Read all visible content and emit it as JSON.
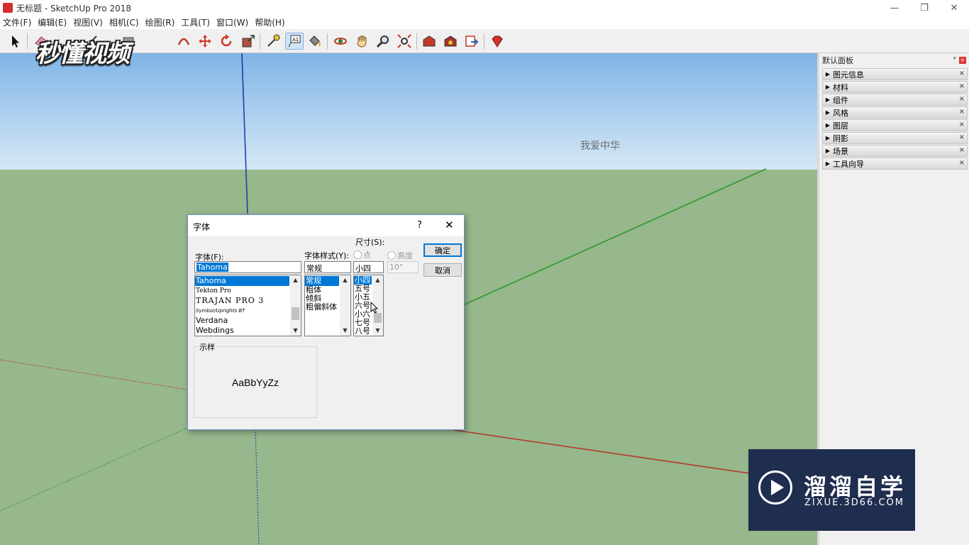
{
  "window": {
    "title": "无标题 - SketchUp Pro 2018",
    "controls": [
      "—",
      "❐",
      "✕"
    ]
  },
  "menu": [
    "文件(F)",
    "编辑(E)",
    "视图(V)",
    "相机(C)",
    "绘图(R)",
    "工具(T)",
    "窗口(W)",
    "帮助(H)"
  ],
  "toolbar": {
    "icons": [
      "select-icon",
      "eraser-icon",
      "line-icon",
      "rectangle-icon",
      "arc-icon",
      "move-icon",
      "rotate-icon",
      "push-pull-icon",
      "tape-measure-icon",
      "text-icon",
      "paint-bucket-icon",
      "orbit-icon",
      "pan-icon",
      "zoom-icon",
      "zoom-extents-icon",
      "warehouse-icon",
      "extension-icon",
      "send-to-layout-icon",
      "ruby-icon"
    ]
  },
  "viewport": {
    "text_label": "我爱中华",
    "watermark_top": "秒懂视频"
  },
  "tray": {
    "title": "默认面板",
    "pin": "ᵖ",
    "close": "×",
    "items": [
      "图元信息",
      "材料",
      "组件",
      "风格",
      "图层",
      "阴影",
      "场景",
      "工具向导"
    ]
  },
  "dialog": {
    "title": "字体",
    "help": "?",
    "close": "✕",
    "font_label": "字体(F):",
    "font_value": "Tahoma",
    "font_list": [
      "Tahoma",
      "Tekton Pro",
      "TRAJAN PRO 3",
      "Symbol/Uprights BT",
      "Verdana",
      "Webdings"
    ],
    "style_label": "字体样式(Y):",
    "style_value": "常规",
    "style_list": [
      "常规",
      "粗体",
      "倾斜",
      "粗偏斜体"
    ],
    "size_group_label": "尺寸(S):",
    "size_radio_point": "点",
    "size_radio_height": "高度",
    "size_value": "小四",
    "height_value": "10\"",
    "size_list": [
      "小四",
      "五号",
      "小五",
      "六号",
      "小六",
      "七号",
      "八号"
    ],
    "ok_label": "确定",
    "cancel_label": "取消",
    "sample_label": "示样",
    "sample_text": "AaBbYyZz"
  },
  "watermark": {
    "brand_cn": "溜溜自学",
    "brand_url": "ZIXUE.3D66.COM"
  },
  "colors": {
    "sky_top": "#7fb4e6",
    "ground": "#97b78c",
    "selection": "#0078d7",
    "axis_red": "#b23a2a",
    "axis_green": "#2e9a2e",
    "axis_blue": "#1f3ea8"
  }
}
